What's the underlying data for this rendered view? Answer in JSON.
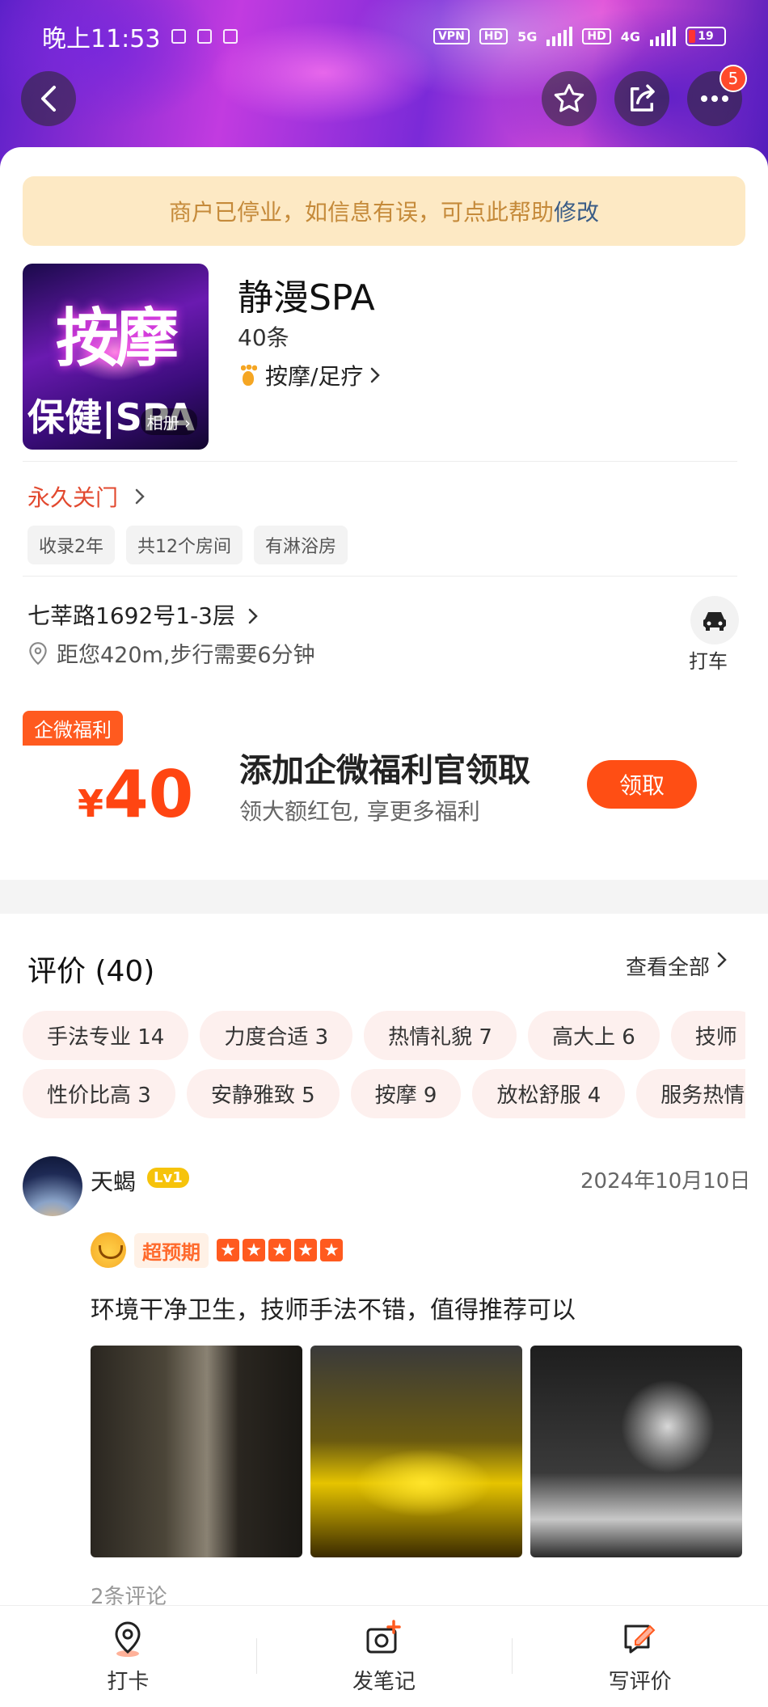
{
  "status_bar": {
    "time": "晚上11:53",
    "network": "VPN",
    "hd1": "HD",
    "net1": "5G",
    "hd2": "HD",
    "net2": "4G",
    "battery": "19"
  },
  "top_actions": {
    "more_badge": "5"
  },
  "notice": {
    "text": "商户已停业，如信息有误，可点此帮助",
    "link": "修改"
  },
  "shop": {
    "image_big_text": "按摩",
    "image_sub_text": "保健|SPA",
    "album_label": "相册 ›",
    "name": "静漫SPA",
    "review_count": "40条",
    "category": "按摩/足疗",
    "status": "永久关门",
    "tags": [
      "收录2年",
      "共12个房间",
      "有淋浴房"
    ],
    "address": "七莘路1692号1-3层",
    "distance": "距您420m,步行需要6分钟",
    "taxi_label": "打车"
  },
  "welfare": {
    "tag": "企微福利",
    "currency": "¥",
    "amount": "40",
    "title": "添加企微福利官领取",
    "subtitle": "领大额红包, 享更多福利",
    "button": "领取"
  },
  "reviews": {
    "title": "评价 (40)",
    "view_all": "查看全部",
    "pills_row1": [
      "手法专业 14",
      "力度合适 3",
      "热情礼貌 7",
      "高大上 6",
      "技师"
    ],
    "pills_row2": [
      "性价比高 3",
      "安静雅致 5",
      "按摩 9",
      "放松舒服 4",
      "服务热情"
    ],
    "items": [
      {
        "user": "天蝎",
        "level": "Lv1",
        "date": "2024年10月10日",
        "rating_label": "超预期",
        "stars": 5,
        "text": "环境干净卫生，技师手法不错，值得推荐可以",
        "comments": "2条评论"
      }
    ]
  },
  "bottom_bar": {
    "checkin": "打卡",
    "post_note": "发笔记",
    "write_review": "写评价"
  },
  "colors": {
    "accent": "#ff4e14",
    "notice_bg": "#fde9c4",
    "notice_text": "#c58a3a",
    "closed_text": "#e2492f"
  }
}
